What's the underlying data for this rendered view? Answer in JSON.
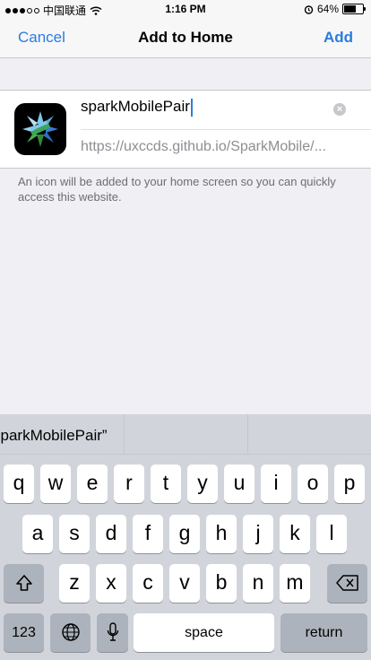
{
  "status_bar": {
    "carrier": "中国联通",
    "time": "1:16 PM",
    "battery": "64%",
    "battery_level": 0.64
  },
  "nav": {
    "cancel": "Cancel",
    "title": "Add to Home",
    "add": "Add"
  },
  "form": {
    "title_value": "sparkMobilePair",
    "url": "https://uxccds.github.io/SparkMobile/...",
    "info": "An icon will be added to your home screen so you can quickly access this website."
  },
  "keyboard": {
    "suggestion": "sparkMobilePair”",
    "row1": [
      "q",
      "w",
      "e",
      "r",
      "t",
      "y",
      "u",
      "i",
      "o",
      "p"
    ],
    "row2": [
      "a",
      "s",
      "d",
      "f",
      "g",
      "h",
      "j",
      "k",
      "l"
    ],
    "row3": [
      "z",
      "x",
      "c",
      "v",
      "b",
      "n",
      "m"
    ],
    "numbers_label": "123",
    "space_label": "space",
    "return_label": "return"
  },
  "colors": {
    "accent": "#2a7ce0",
    "background": "#efeff4",
    "keyboard": "#d1d5db"
  },
  "icons": [
    "signal-dots",
    "wifi-icon",
    "alarm-icon",
    "battery-icon",
    "app-icon",
    "clear-icon",
    "shift-icon",
    "delete-icon",
    "globe-icon",
    "mic-icon"
  ]
}
